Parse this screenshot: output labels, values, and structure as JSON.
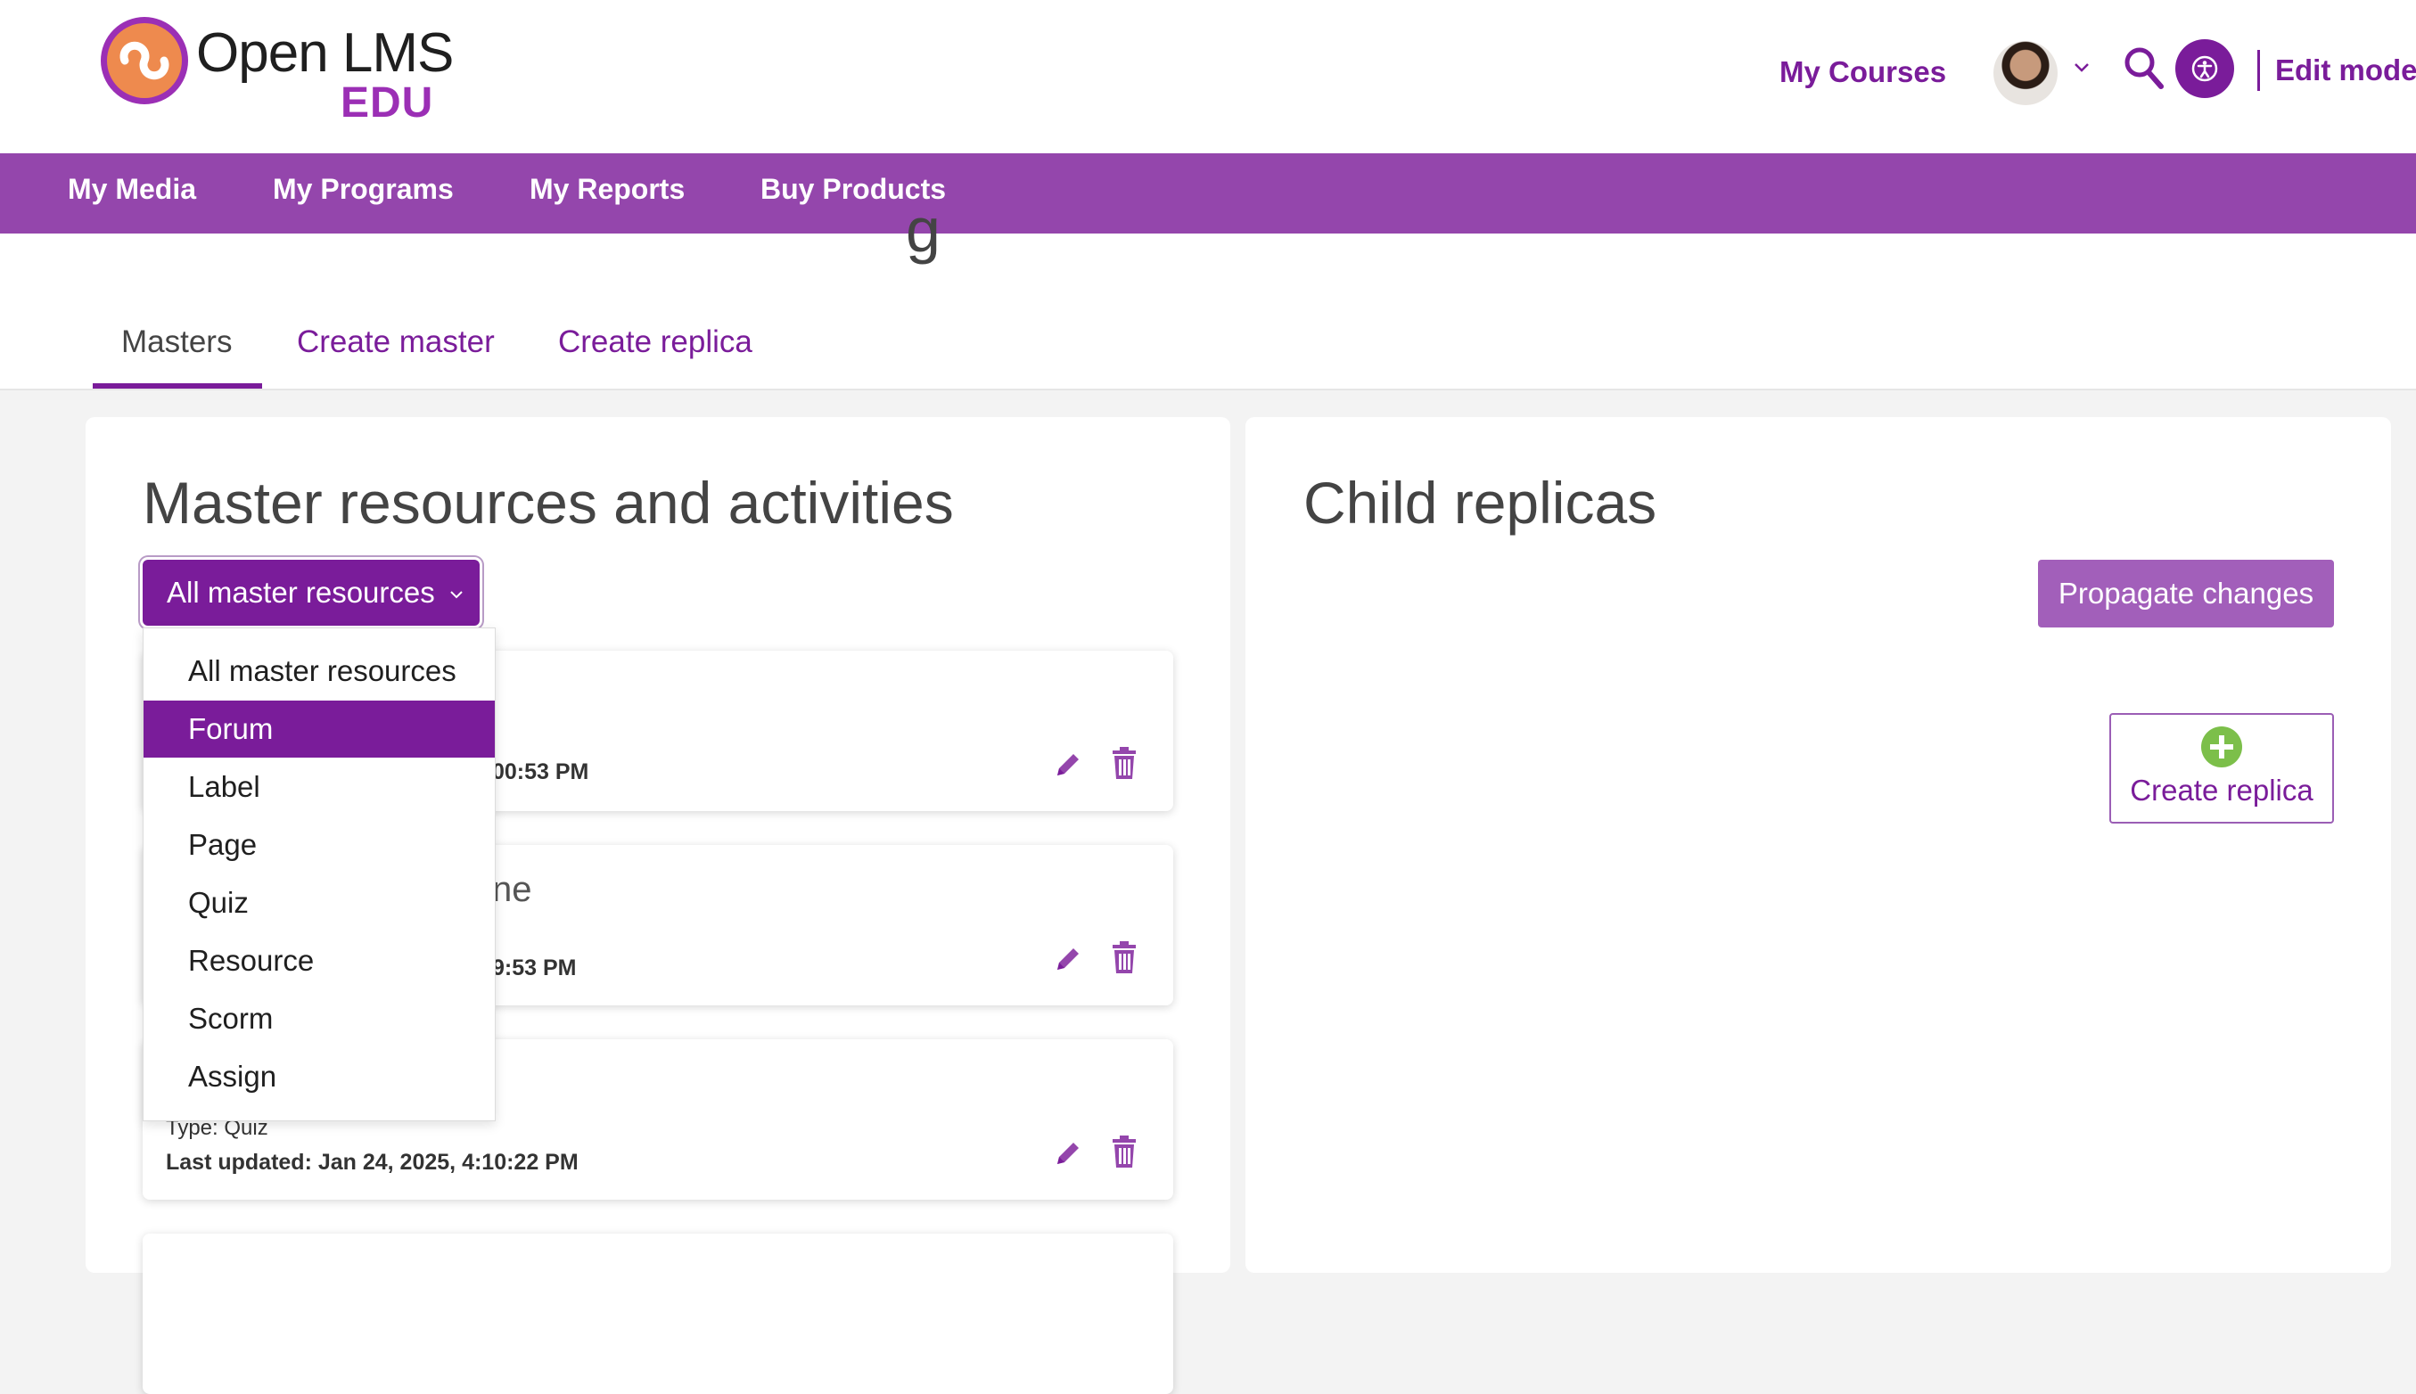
{
  "header": {
    "logo_name": "Open LMS",
    "logo_sub": "EDU",
    "my_courses": "My Courses",
    "edit_mode": "Edit mode",
    "brand_color": "#7a1c9a"
  },
  "nav": {
    "items": [
      "My Media",
      "My Programs",
      "My Reports",
      "Buy Products"
    ],
    "color": "#9446ac"
  },
  "page": {
    "partial_heading_char": "g"
  },
  "tabs": [
    {
      "label": "Masters",
      "active": true
    },
    {
      "label": "Create master",
      "active": false
    },
    {
      "label": "Create replica",
      "active": false
    }
  ],
  "left_panel": {
    "title": "Master resources and activities",
    "filter": {
      "selected_label": "All master resources",
      "options": [
        "All master resources",
        "Forum",
        "Label",
        "Page",
        "Quiz",
        "Resource",
        "Scorm",
        "Assign"
      ],
      "highlighted_option": "Forum"
    },
    "cards": [
      {
        "title_visible": "",
        "type": "",
        "updated_visible": "00:53 PM"
      },
      {
        "title_visible": "ne",
        "type": "",
        "updated_visible": "9:53 PM"
      },
      {
        "title_visible": "",
        "type": "Type: Quiz",
        "updated_visible": "Last updated: Jan 24, 2025, 4:10:22 PM"
      }
    ]
  },
  "right_panel": {
    "title": "Child replicas",
    "propagate_label": "Propagate changes",
    "create_replica_label": "Create replica"
  },
  "icons": [
    "logo-icon",
    "chevron-down-icon",
    "search-icon",
    "accessibility-icon",
    "pencil-icon",
    "trash-icon",
    "plus-circle-icon"
  ]
}
